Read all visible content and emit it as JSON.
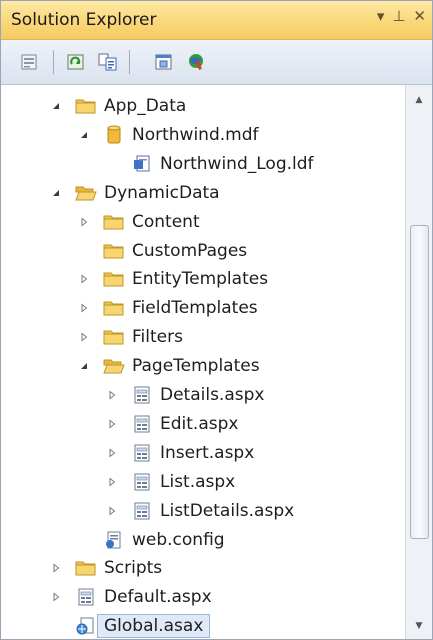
{
  "window": {
    "title": "Solution Explorer",
    "controls": {
      "dropdown": "▾",
      "pin": "⊥",
      "close": "✕"
    }
  },
  "toolbar": {
    "buttons": [
      {
        "icon": "properties-icon"
      },
      {
        "icon": "refresh-icon"
      },
      {
        "icon": "show-all-files-icon"
      },
      {
        "icon": "view-class-diagram-icon"
      },
      {
        "icon": "web-configuration-icon"
      }
    ]
  },
  "tree": {
    "items": [
      {
        "label": "App_Data",
        "level": 0,
        "expander": "expanded",
        "icon": "folder-icon"
      },
      {
        "label": "Northwind.mdf",
        "level": 1,
        "expander": "expanded",
        "icon": "database-icon"
      },
      {
        "label": "Northwind_Log.ldf",
        "level": 2,
        "expander": "none",
        "icon": "log-file-icon"
      },
      {
        "label": "DynamicData",
        "level": 0,
        "expander": "expanded",
        "icon": "folder-open-icon"
      },
      {
        "label": "Content",
        "level": 1,
        "expander": "collapsed",
        "icon": "folder-icon"
      },
      {
        "label": "CustomPages",
        "level": 1,
        "expander": "none",
        "icon": "folder-icon"
      },
      {
        "label": "EntityTemplates",
        "level": 1,
        "expander": "collapsed",
        "icon": "folder-icon"
      },
      {
        "label": "FieldTemplates",
        "level": 1,
        "expander": "collapsed",
        "icon": "folder-icon"
      },
      {
        "label": "Filters",
        "level": 1,
        "expander": "collapsed",
        "icon": "folder-icon"
      },
      {
        "label": "PageTemplates",
        "level": 1,
        "expander": "expanded",
        "icon": "folder-open-icon"
      },
      {
        "label": "Details.aspx",
        "level": 2,
        "expander": "collapsed",
        "icon": "aspx-file-icon"
      },
      {
        "label": "Edit.aspx",
        "level": 2,
        "expander": "collapsed",
        "icon": "aspx-file-icon"
      },
      {
        "label": "Insert.aspx",
        "level": 2,
        "expander": "collapsed",
        "icon": "aspx-file-icon"
      },
      {
        "label": "List.aspx",
        "level": 2,
        "expander": "collapsed",
        "icon": "aspx-file-icon"
      },
      {
        "label": "ListDetails.aspx",
        "level": 2,
        "expander": "collapsed",
        "icon": "aspx-file-icon"
      },
      {
        "label": "web.config",
        "level": 1,
        "expander": "none",
        "icon": "config-file-icon"
      },
      {
        "label": "Scripts",
        "level": 0,
        "expander": "collapsed",
        "icon": "folder-icon"
      },
      {
        "label": "Default.aspx",
        "level": 0,
        "expander": "collapsed",
        "icon": "aspx-file-icon"
      },
      {
        "label": "Global.asax",
        "level": 0,
        "expander": "none",
        "icon": "asax-file-icon",
        "selected": true
      }
    ]
  },
  "colors": {
    "title_bar": "#f9d677",
    "selection": "#dfe9f7",
    "folder": "#f2c24e"
  }
}
